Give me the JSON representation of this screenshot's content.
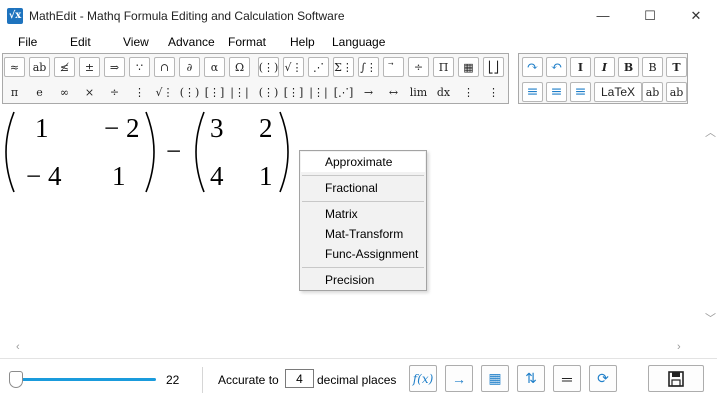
{
  "window": {
    "title": "MathEdit - Mathq Formula Editing and Calculation Software",
    "icon": "sqrt-x-icon",
    "controls": {
      "minimize": "—",
      "maximize": "☐",
      "close": "✕"
    }
  },
  "menu": [
    "File",
    "Edit",
    "View",
    "Advance",
    "Format",
    "Help",
    "Language"
  ],
  "toolbar_row1": [
    "≈",
    "ab",
    "≰",
    "±",
    "⇒",
    "∵",
    "∩",
    "∂",
    "α",
    "Ω",
    "(⋮)",
    "√⋮",
    "⋰",
    "Σ⋮",
    "∫⋮",
    "⃗",
    "÷",
    "Π",
    "▦",
    "⎣⎦"
  ],
  "toolbar_row2": [
    "π",
    "e",
    "∞",
    "×",
    "÷",
    "⋮",
    "√⋮",
    "(⋮)",
    "[⋮]",
    "|⋮|",
    "(⋮)",
    "[⋮]",
    "|⋮|",
    "[⋰]",
    "→",
    "↔",
    "lim",
    "dx",
    "⋮",
    "⋮"
  ],
  "format_row1": [
    "↷",
    "↶",
    "I",
    "I",
    "B",
    "B",
    "T"
  ],
  "format_row2": [
    "≡",
    "≡",
    "≡",
    "LaTeX",
    "ab",
    "ab"
  ],
  "expression": {
    "matrix_a": [
      [
        "1",
        "− 2"
      ],
      [
        "− 4",
        "1"
      ]
    ],
    "operator": "−",
    "matrix_b": [
      [
        "3",
        "2"
      ],
      [
        "4",
        "1"
      ]
    ]
  },
  "context_menu": {
    "items": [
      {
        "label": "Approximate"
      },
      {
        "label": "Fractional"
      },
      {
        "label": "Matrix"
      },
      {
        "label": "Mat-Transform"
      },
      {
        "label": "Func-Assignment"
      },
      {
        "label": "Precision"
      }
    ]
  },
  "status": {
    "font_size": 22,
    "font_size_text": "22",
    "accurate_to": "Accurate to",
    "precision_value": "4",
    "decimal_places": "decimal places",
    "buttons": [
      "f(x)",
      "→",
      "▦",
      "⇅",
      "═",
      "⟳"
    ]
  },
  "colors": {
    "accent": "#1a9bdc",
    "icon_blue": "#1f7fc9",
    "menu_bg": "#f2f2f2"
  }
}
